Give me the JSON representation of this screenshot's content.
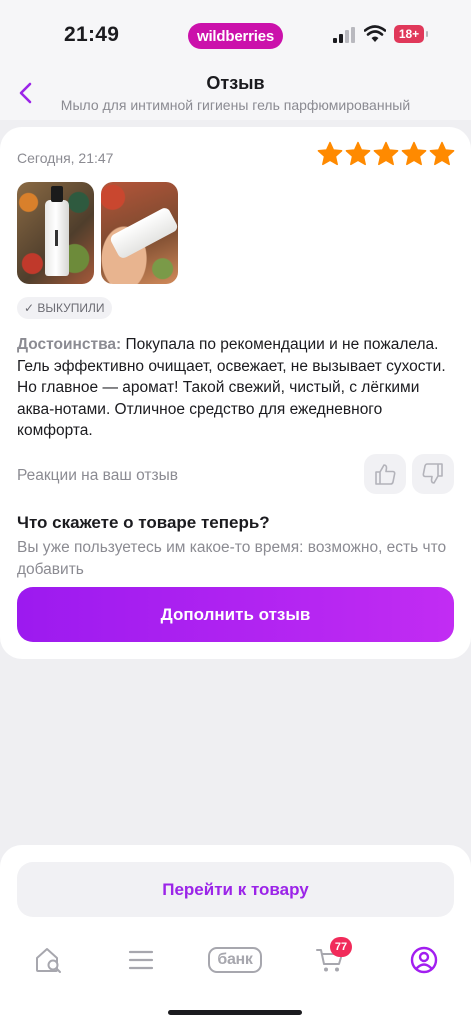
{
  "status_bar": {
    "time": "21:49",
    "brand": "wildberries",
    "battery": "18+",
    "icons": [
      "signal-icon",
      "wifi-icon",
      "battery-icon"
    ]
  },
  "header": {
    "title": "Отзыв",
    "subtitle": "Мыло для интимной гигиены гель парфюмированный",
    "back_icon": "chevron-left-icon"
  },
  "review": {
    "date": "Сегодня, 21:47",
    "rating": 5,
    "photos": [
      "photo-bottle",
      "photo-tube"
    ],
    "badge": "✓ ВЫКУПИЛИ",
    "label": "Достоинства:",
    "text": " Покупала по рекомендации и не пожалела. Гель эффективно очищает, освежает, не вызывает сухости. Но главное — аромат! Такой свежий, чистый, с лёгкими аква-нотами. Отличное средство для ежедневного комфорта.",
    "reactions_label": "Реакции на ваш отзыв",
    "question_title": "Что скажете о товаре теперь?",
    "question_sub": "Вы уже пользуетесь им какое-то время: возможно, есть что добавить",
    "add_button": "Дополнить отзыв"
  },
  "bottom": {
    "goto_button": "Перейти к товару",
    "tabs": {
      "home_icon": "home-search-icon",
      "menu_icon": "menu-icon",
      "bank_label": "банк",
      "cart_icon": "cart-icon",
      "cart_count": "77",
      "profile_icon": "profile-icon"
    }
  },
  "colors": {
    "accent": "#cb11ab",
    "button": "#a21ef0",
    "star": "#ff8a00",
    "badge": "#f12b5a"
  }
}
